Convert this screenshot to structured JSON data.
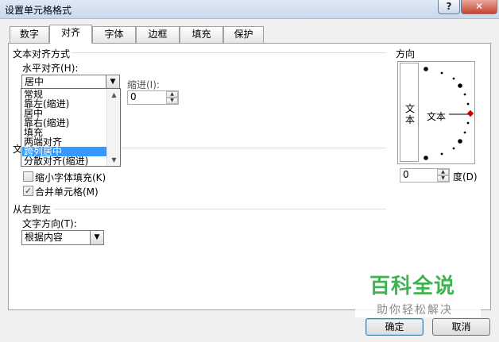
{
  "window": {
    "title": "设置单元格格式",
    "help_label": "?",
    "close_label": "✕"
  },
  "tabs": [
    {
      "label": "数字"
    },
    {
      "label": "对齐"
    },
    {
      "label": "字体"
    },
    {
      "label": "边框"
    },
    {
      "label": "填充"
    },
    {
      "label": "保护"
    }
  ],
  "active_tab": "对齐",
  "text_alignment": {
    "group_title": "文本对齐方式",
    "horizontal_label": "水平对齐(H):",
    "horizontal_value": "居中",
    "indent_label": "缩进(I):",
    "indent_value": "0",
    "dropdown_options": [
      "常规",
      "靠左(缩进)",
      "居中",
      "靠右(缩进)",
      "填充",
      "两端对齐",
      "跨列居中",
      "分散对齐(缩进)"
    ],
    "dropdown_selected": "跨列居中"
  },
  "text_control": {
    "group_title": "文",
    "shrink_label": "缩小字体填充(K)",
    "shrink_checked": false,
    "merge_label": "合并单元格(M)",
    "merge_checked": true,
    "checkmark": "✓"
  },
  "rtl": {
    "group_title": "从右到左",
    "direction_label": "文字方向(T):",
    "direction_value": "根据内容"
  },
  "orientation": {
    "group_title": "方向",
    "vertical_text": "文本",
    "dial_text": "文本",
    "degree_value": "0",
    "degree_label": "度(D)"
  },
  "buttons": {
    "ok": "确定",
    "cancel": "取消"
  },
  "watermark": {
    "title": "百科全说",
    "subtitle": "助你轻松解决"
  },
  "colors": {
    "selection": "#3399ff",
    "dial_marker": "#cc0000",
    "watermark_green": "#3fb34f"
  }
}
